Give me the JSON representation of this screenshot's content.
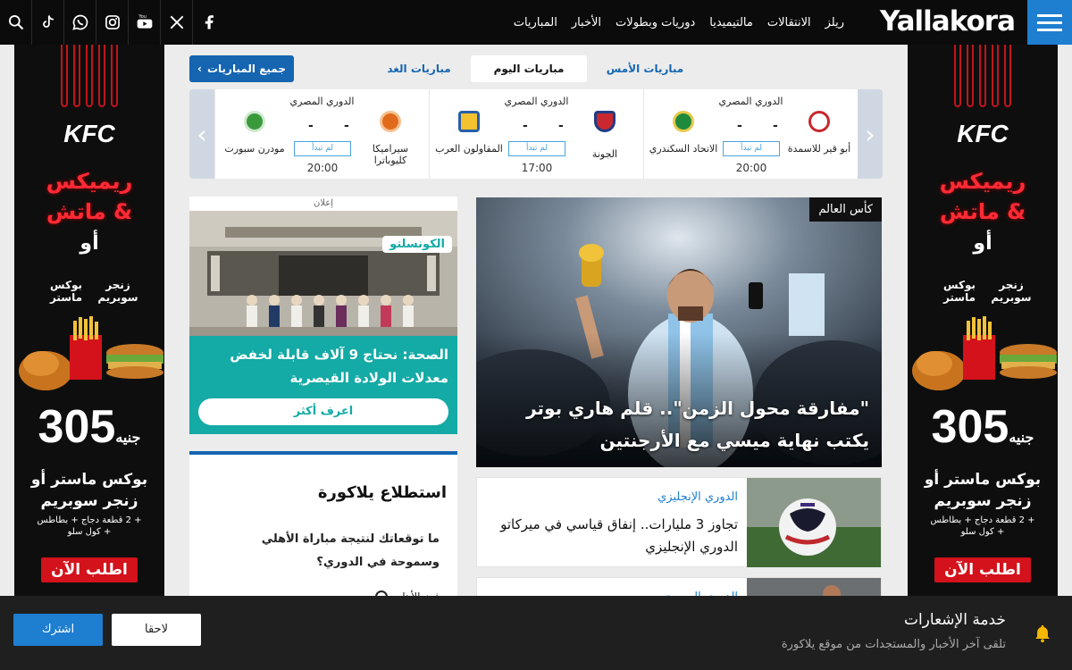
{
  "brand": {
    "logo": "Yallakora",
    "accent": "#1e7ed0"
  },
  "nav": {
    "links": [
      "المباريات",
      "الأخبار",
      "دوريات وبطولات",
      "مالتيميديا",
      "الانتقالات",
      "ريلز"
    ],
    "social_icons": [
      "search-icon",
      "tiktok-icon",
      "whatsapp-icon",
      "instagram-icon",
      "youtube-icon",
      "x-icon",
      "facebook-icon"
    ]
  },
  "side_ad": {
    "brand": "KFC",
    "headline_line1": "ريميكس",
    "headline_line2": "& ماتش",
    "or": "أو",
    "option_a": "زنجر سوبريم",
    "option_b": "بوكس ماستر",
    "price": "305",
    "currency": "جنيه",
    "sub_line1": "بوكس ماستر أو",
    "sub_line2": "زنجر سوبريم",
    "extras_1": "+ 2 قطعة دجاج + بطاطس",
    "extras_2": "+ كول سلو",
    "cta": "اطلب الآن"
  },
  "match_tabs": {
    "all_matches": "جميع المباريات",
    "tomorrow": "مباريات الغد",
    "today": "مباريات اليوم",
    "yesterday": "مباريات الأمس"
  },
  "matches": [
    {
      "league": "الدوري المصري",
      "home": "أبو قير للاسمدة",
      "away": "الاتحاد السكندري",
      "home_score": "-",
      "away_score": "-",
      "status": "لم تبدأ",
      "time": "20:00"
    },
    {
      "league": "الدوري المصري",
      "home": "الجونة",
      "away": "المقاولون العرب",
      "home_score": "-",
      "away_score": "-",
      "status": "لم تبدأ",
      "time": "17:00"
    },
    {
      "league": "الدوري المصري",
      "home": "سيراميكا كليوباترا",
      "away": "مودرن سبورت",
      "home_score": "-",
      "away_score": "-",
      "status": "لم تبدأ",
      "time": "20:00"
    }
  ],
  "ad_card": {
    "label": "إعلان",
    "tag": "الكونسلتو",
    "title": "الصحة: نحتاج 9 آلاف قابلة لخفض معدلات الولادة القيصرية",
    "button": "اعرف أكثر"
  },
  "poll": {
    "title": "استطلاع يلاكورة",
    "question": "ما توقعاتك لنتيجة مباراة الأهلي وسموحة في الدوري؟",
    "option_1": "فوز الأهلي"
  },
  "hero": {
    "category": "كأس العالم",
    "title": "\"مفارقة محول الزمن\".. قلم هاري بوتر يكتب نهاية ميسي مع الأرجنتين"
  },
  "news": [
    {
      "category": "الدوري الإنجليزي",
      "title": "تجاوز 3 مليارات.. إنفاق قياسي في ميركاتو الدوري الإنجليزي"
    },
    {
      "category": "الدوري المصري",
      "title": ""
    }
  ],
  "notification": {
    "title": "خدمة الإشعارات",
    "subtitle": "تلقى آخر الأخبار والمستجدات من موقع يلاكورة",
    "later": "لاحقا",
    "subscribe": "اشترك"
  }
}
